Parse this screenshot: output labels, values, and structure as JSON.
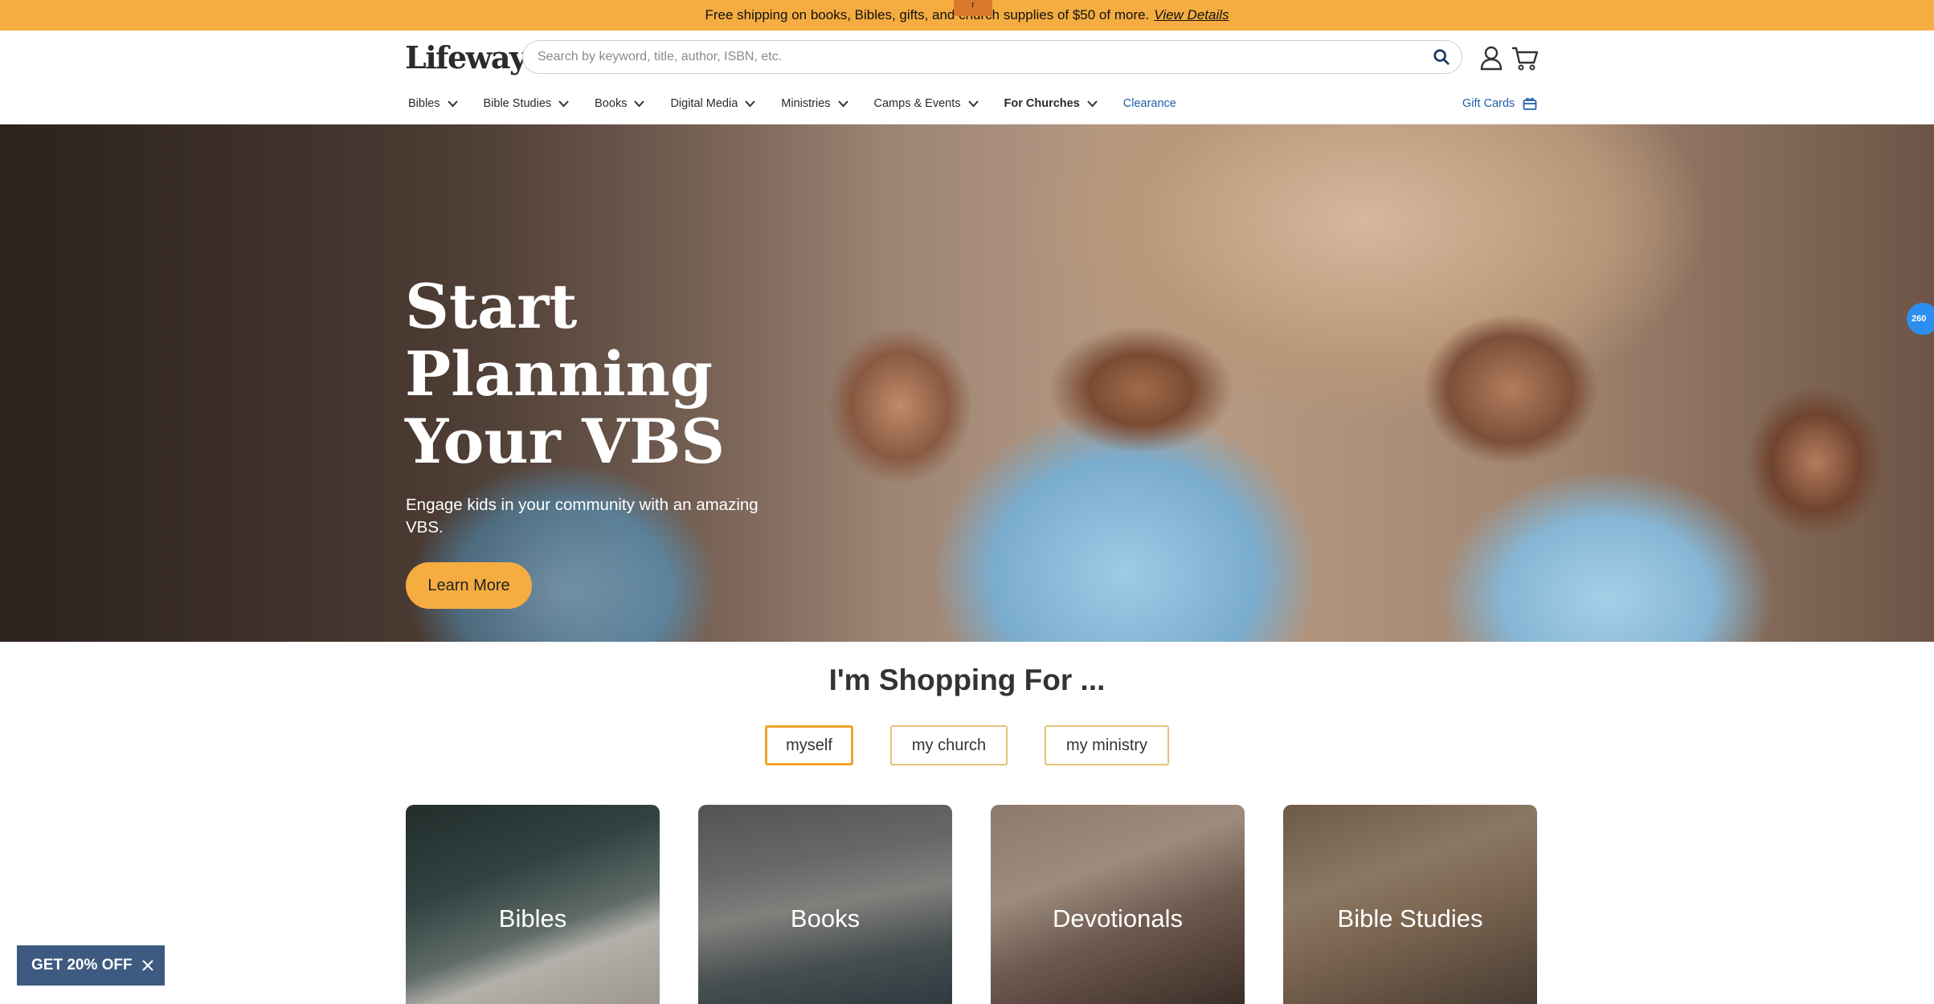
{
  "promo": {
    "text": "Free shipping on books, Bibles, gifts, and church supplies of $50 of more.",
    "link": "View Details",
    "tab": "r"
  },
  "header": {
    "logo": "Lifeway",
    "search_placeholder": "Search by keyword, title, author, ISBN, etc.",
    "icons": [
      "search-icon",
      "account-icon",
      "cart-icon"
    ]
  },
  "nav": {
    "items": [
      {
        "label": "Bibles"
      },
      {
        "label": "Bible Studies"
      },
      {
        "label": "Books"
      },
      {
        "label": "Digital Media"
      },
      {
        "label": "Ministries"
      },
      {
        "label": "Camps & Events"
      },
      {
        "label": "For Churches"
      },
      {
        "label": "Clearance"
      }
    ],
    "gift_cards": "Gift Cards"
  },
  "hero": {
    "title": "Start Planning Your VBS",
    "subtitle": "Engage kids in your community with an amazing VBS.",
    "button": "Learn More",
    "badge": "260"
  },
  "shopping": {
    "title": "I'm Shopping For ...",
    "options": [
      "myself",
      "my church",
      "my ministry"
    ],
    "selected": "myself"
  },
  "categories": [
    {
      "label": "Bibles"
    },
    {
      "label": "Books"
    },
    {
      "label": "Devotionals"
    },
    {
      "label": "Bible Studies"
    }
  ],
  "offer": {
    "label": "GET 20% OFF"
  },
  "colors": {
    "promo_bg": "#f5ad41",
    "link_blue": "#1f5fa8",
    "offer_bg": "#3d5a80"
  }
}
